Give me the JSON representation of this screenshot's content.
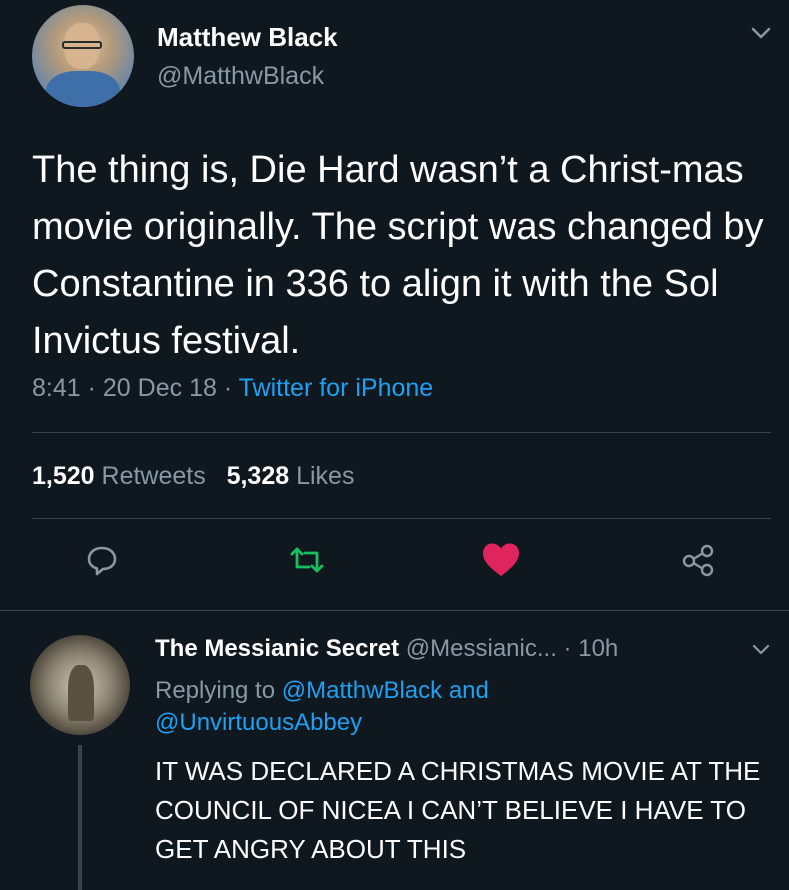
{
  "tweet": {
    "author_name": "Matthew Black",
    "author_handle": "@MatthwBlack",
    "text": "The thing is, Die Hard wasn’t a Christ-mas movie originally. The script was changed by Constantine in 336 to align it with the Sol Invictus festival.",
    "time": "8:41",
    "date": "20 Dec 18",
    "source": "Twitter for iPhone",
    "retweets_count": "1,520",
    "retweets_label": "Retweets",
    "likes_count": "5,328",
    "likes_label": "Likes",
    "liked": true
  },
  "actions": {
    "reply_icon": "reply-icon",
    "retweet_icon": "retweet-icon",
    "like_icon": "heart-icon",
    "share_icon": "share-icon"
  },
  "reply": {
    "author_name": "The Messianic Secret",
    "author_handle": "@Messianic...",
    "time_ago": "10h",
    "replying_prefix": "Replying to",
    "mention_1": "@MatthwBlack",
    "and_word": "and",
    "mention_2": "@UnvirtuousAbbey",
    "text": "IT WAS DECLARED A CHRISTMAS MOVIE AT THE COUNCIL OF NICEA I CAN’T BELIEVE I HAVE TO GET ANGRY ABOUT THIS"
  },
  "colors": {
    "background": "#0f171f",
    "accent": "#1da1f2",
    "retweet": "#17bf63",
    "like": "#e0245e",
    "secondary_text": "#8899a6"
  }
}
